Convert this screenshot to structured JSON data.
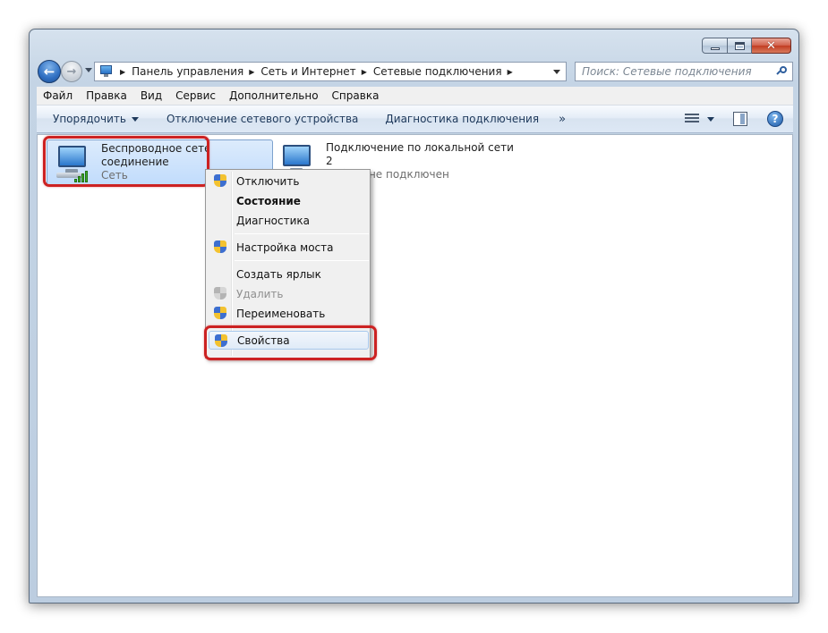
{
  "window": {
    "controls": {
      "minimize": "",
      "maximize": "",
      "close": "✕"
    }
  },
  "address": {
    "crumbs": [
      "Панель управления",
      "Сеть и Интернет",
      "Сетевые подключения"
    ],
    "search_placeholder": "Поиск: Сетевые подключения"
  },
  "menu": [
    "Файл",
    "Правка",
    "Вид",
    "Сервис",
    "Дополнительно",
    "Справка"
  ],
  "commands": {
    "organize": "Упорядочить",
    "disable_device": "Отключение сетевого устройства",
    "diagnose": "Диагностика подключения",
    "more": "»",
    "help": "?"
  },
  "connections": [
    {
      "title_line1": "Беспроводное сетево",
      "title_line2": "соединение",
      "status": "Сеть"
    },
    {
      "title_line1": "Подключение по локальной сети",
      "title_line2": "2",
      "status": "кабель не подключен"
    }
  ],
  "context_menu": {
    "items": [
      {
        "label": "Отключить",
        "shield": true
      },
      {
        "label": "Состояние",
        "bold": true
      },
      {
        "label": "Диагностика"
      },
      {
        "label": "Настройка моста",
        "shield": true
      },
      {
        "label": "Создать ярлык"
      },
      {
        "label": "Удалить",
        "shield": true,
        "disabled": true
      },
      {
        "label": "Переименовать",
        "shield": true
      },
      {
        "label": "Свойства",
        "shield": true,
        "highlighted": true
      }
    ]
  },
  "colors": {
    "highlight_frame": "#cc2222",
    "selection": "#c1dcfc",
    "command_text": "#1e395b"
  }
}
